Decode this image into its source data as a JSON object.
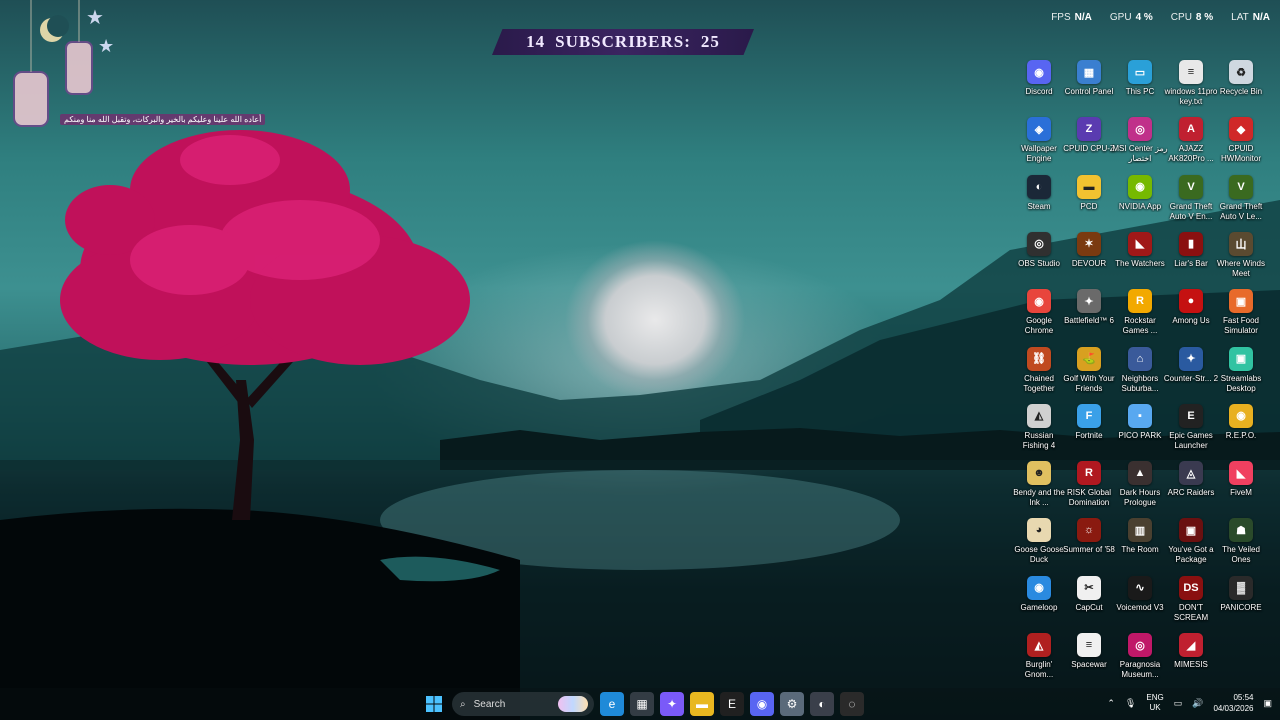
{
  "stats": [
    {
      "key": "FPS",
      "value": "N/A"
    },
    {
      "key": "GPU",
      "value": "4 %"
    },
    {
      "key": "CPU",
      "value": "8 %"
    },
    {
      "key": "LAT",
      "value": "N/A"
    }
  ],
  "subscribers": {
    "left": "14",
    "label": "SUBSCRIBERS:",
    "right": "25"
  },
  "ramadan_text": "أعاده الله علينا وعليكم بالخير والبركات، وتقبل الله منا ومنكم",
  "desktop_icons": [
    {
      "label": "Discord",
      "icon": "discord-icon",
      "color": "#5865f2",
      "glyph": "◉"
    },
    {
      "label": "Control Panel",
      "icon": "control-panel-icon",
      "color": "#3a7fd0",
      "glyph": "▦"
    },
    {
      "label": "This PC",
      "icon": "this-pc-icon",
      "color": "#2aa0d8",
      "glyph": "▭"
    },
    {
      "label": "windows 11pro key.txt",
      "icon": "text-file-icon",
      "color": "#e8e8e8",
      "glyph": "≡"
    },
    {
      "label": "Recycle Bin",
      "icon": "recycle-bin-icon",
      "color": "#cfd8e0",
      "glyph": "♻"
    },
    {
      "label": "Wallpaper Engine",
      "icon": "wallpaper-engine-icon",
      "color": "#2a6fd8",
      "glyph": "◈"
    },
    {
      "label": "CPUID CPU-Z",
      "icon": "cpuz-icon",
      "color": "#5a3bb0",
      "glyph": "Z"
    },
    {
      "label": "MSI Center رمز اختصار",
      "icon": "msi-center-icon",
      "color": "#c0308a",
      "glyph": "◎"
    },
    {
      "label": "AJAZZ AK820Pro ...",
      "icon": "ajazz-icon",
      "color": "#c02030",
      "glyph": "A"
    },
    {
      "label": "CPUID HWMonitor",
      "icon": "hwmonitor-icon",
      "color": "#d02828",
      "glyph": "◆"
    },
    {
      "label": "Steam",
      "icon": "steam-icon",
      "color": "#1b2838",
      "glyph": "◐"
    },
    {
      "label": "PCD",
      "icon": "folder-icon",
      "color": "#f2c230",
      "glyph": "▬"
    },
    {
      "label": "NVIDIA App",
      "icon": "nvidia-icon",
      "color": "#76b900",
      "glyph": "◉"
    },
    {
      "label": "Grand Theft Auto V En...",
      "icon": "gta-v-icon",
      "color": "#3a6a20",
      "glyph": "V"
    },
    {
      "label": "Grand Theft Auto V Le...",
      "icon": "gta-v-legacy-icon",
      "color": "#3a6a20",
      "glyph": "V"
    },
    {
      "label": "OBS Studio",
      "icon": "obs-icon",
      "color": "#303030",
      "glyph": "◎"
    },
    {
      "label": "DEVOUR",
      "icon": "devour-icon",
      "color": "#7a3a10",
      "glyph": "✶"
    },
    {
      "label": "The Watchers",
      "icon": "the-watchers-icon",
      "color": "#a01818",
      "glyph": "◣"
    },
    {
      "label": "Liar's Bar",
      "icon": "liars-bar-icon",
      "color": "#8a1010",
      "glyph": "▮"
    },
    {
      "label": "Where Winds Meet",
      "icon": "where-winds-meet-icon",
      "color": "#5a4a30",
      "glyph": "山"
    },
    {
      "label": "Google Chrome",
      "icon": "chrome-icon",
      "color": "#e8453c",
      "glyph": "◉"
    },
    {
      "label": "Battlefield™ 6",
      "icon": "battlefield-icon",
      "color": "#6a6a6a",
      "glyph": "✦"
    },
    {
      "label": "Rockstar Games ...",
      "icon": "rockstar-icon",
      "color": "#f2a900",
      "glyph": "R"
    },
    {
      "label": "Among Us",
      "icon": "among-us-icon",
      "color": "#c51111",
      "glyph": "●"
    },
    {
      "label": "Fast Food Simulator",
      "icon": "fast-food-icon",
      "color": "#e86a2a",
      "glyph": "▣"
    },
    {
      "label": "Chained Together",
      "icon": "chained-together-icon",
      "color": "#c04a20",
      "glyph": "⛓"
    },
    {
      "label": "Golf With Your Friends",
      "icon": "golf-icon",
      "color": "#d8a020",
      "glyph": "⛳"
    },
    {
      "label": "Neighbors Suburba...",
      "icon": "neighbors-icon",
      "color": "#3a5a9a",
      "glyph": "⌂"
    },
    {
      "label": "Counter-Str... 2",
      "icon": "cs2-icon",
      "color": "#2a5aa0",
      "glyph": "✦"
    },
    {
      "label": "Streamlabs Desktop",
      "icon": "streamlabs-icon",
      "color": "#31c3a2",
      "glyph": "▣"
    },
    {
      "label": "Russian Fishing 4",
      "icon": "russian-fishing-icon",
      "color": "#d0d0d0",
      "glyph": "◭"
    },
    {
      "label": "Fortnite",
      "icon": "fortnite-icon",
      "color": "#3aa0e8",
      "glyph": "F"
    },
    {
      "label": "PICO PARK",
      "icon": "pico-park-icon",
      "color": "#58a8f0",
      "glyph": "▪"
    },
    {
      "label": "Epic Games Launcher",
      "icon": "epic-games-icon",
      "color": "#222222",
      "glyph": "E"
    },
    {
      "label": "R.E.P.O.",
      "icon": "repo-icon",
      "color": "#e8b020",
      "glyph": "◉"
    },
    {
      "label": "Bendy and the Ink ...",
      "icon": "bendy-icon",
      "color": "#e0c060",
      "glyph": "☻"
    },
    {
      "label": "RISK Global Domination",
      "icon": "risk-icon",
      "color": "#b01820",
      "glyph": "R"
    },
    {
      "label": "Dark Hours Prologue",
      "icon": "dark-hours-icon",
      "color": "#3a3030",
      "glyph": "▲"
    },
    {
      "label": "ARC Raiders",
      "icon": "arc-raiders-icon",
      "color": "#3a3a50",
      "glyph": "◬"
    },
    {
      "label": "FiveM",
      "icon": "fivem-icon",
      "color": "#f04060",
      "glyph": "◣"
    },
    {
      "label": "Goose Goose Duck",
      "icon": "goose-goose-duck-icon",
      "color": "#e8d8b0",
      "glyph": "◕"
    },
    {
      "label": "Summer of '58",
      "icon": "summer-58-icon",
      "color": "#8a1a10",
      "glyph": "☼"
    },
    {
      "label": "The Room",
      "icon": "the-room-icon",
      "color": "#4a4030",
      "glyph": "▥"
    },
    {
      "label": "You've Got a Package",
      "icon": "package-icon",
      "color": "#6a1010",
      "glyph": "▣"
    },
    {
      "label": "The Veiled Ones",
      "icon": "veiled-ones-icon",
      "color": "#2a4a2a",
      "glyph": "☗"
    },
    {
      "label": "Gameloop",
      "icon": "gameloop-icon",
      "color": "#2a8ae0",
      "glyph": "◉"
    },
    {
      "label": "CapCut",
      "icon": "capcut-icon",
      "color": "#f0f0f0",
      "glyph": "✂"
    },
    {
      "label": "Voicemod V3",
      "icon": "voicemod-icon",
      "color": "#1a1a1a",
      "glyph": "∿"
    },
    {
      "label": "DON'T SCREAM",
      "icon": "dont-scream-icon",
      "color": "#8a1010",
      "glyph": "DS"
    },
    {
      "label": "PANICORE",
      "icon": "panicore-icon",
      "color": "#2a2a2a",
      "glyph": "▓"
    },
    {
      "label": "Burglin' Gnom...",
      "icon": "burglin-gnomes-icon",
      "color": "#b02020",
      "glyph": "◭"
    },
    {
      "label": "Spacewar",
      "icon": "spacewar-icon",
      "color": "#f0f0f0",
      "glyph": "≡"
    },
    {
      "label": "Paragnosia Museum...",
      "icon": "paragnosia-icon",
      "color": "#c01868",
      "glyph": "◎"
    },
    {
      "label": "MIMESIS",
      "icon": "mimesis-icon",
      "color": "#c02030",
      "glyph": "◢"
    }
  ],
  "taskbar": {
    "search_placeholder": "Search",
    "apps": [
      {
        "name": "edge-icon",
        "color": "#1f8ad8",
        "glyph": "e"
      },
      {
        "name": "store-icon",
        "color": "#333c44",
        "glyph": "▦"
      },
      {
        "name": "copilot-icon",
        "color": "#7a5af8",
        "glyph": "✦"
      },
      {
        "name": "file-explorer-icon",
        "color": "#e8b820",
        "glyph": "▬"
      },
      {
        "name": "epic-games-taskbar-icon",
        "color": "#202020",
        "glyph": "E"
      },
      {
        "name": "discord-taskbar-icon",
        "color": "#5865f2",
        "glyph": "◉"
      },
      {
        "name": "settings-icon",
        "color": "#5a6a7a",
        "glyph": "⚙"
      },
      {
        "name": "steam-taskbar-icon",
        "color": "#3a3f4a",
        "glyph": "◐"
      },
      {
        "name": "recorder-icon",
        "color": "#2a2a2a",
        "glyph": "◌"
      }
    ],
    "lang": {
      "line1": "ENG",
      "line2": "UK"
    },
    "time": "05:54",
    "date": "04/03/2026"
  }
}
